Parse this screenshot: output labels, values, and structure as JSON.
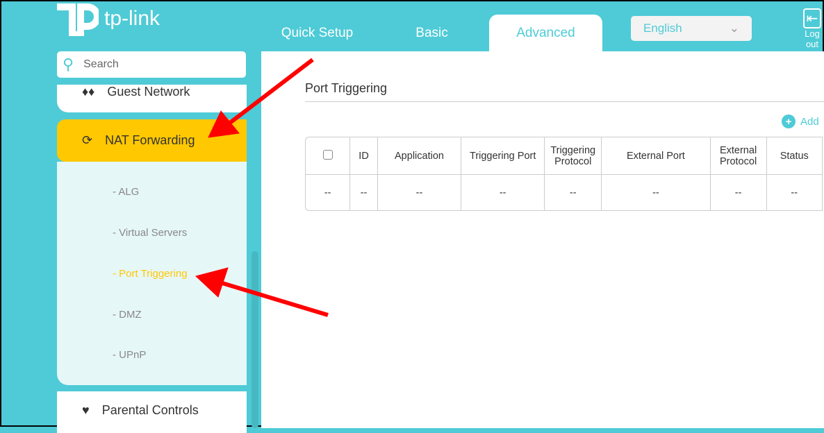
{
  "brand": "tp-link",
  "nav": {
    "tabs": [
      "Quick Setup",
      "Basic",
      "Advanced"
    ],
    "active": "Advanced"
  },
  "language": "English",
  "logout": "Log out",
  "search_placeholder": "Search",
  "sidebar": {
    "guest": "Guest Network",
    "nat": "NAT Forwarding",
    "sub": [
      "- ALG",
      "- Virtual Servers",
      "- Port Triggering",
      "- DMZ",
      "- UPnP"
    ],
    "active_sub": "- Port Triggering",
    "parental": "Parental Controls"
  },
  "content": {
    "title": "Port Triggering",
    "add": "Add",
    "columns": [
      "ID",
      "Application",
      "Triggering Port",
      "Triggering Protocol",
      "External Port",
      "External Protocol",
      "Status"
    ],
    "row": [
      "--",
      "--",
      "--",
      "--",
      "--",
      "--",
      "--",
      "--"
    ]
  },
  "colors": {
    "teal": "#4ecbd6",
    "yellow": "#ffc800",
    "arrow": "#ff0000"
  }
}
